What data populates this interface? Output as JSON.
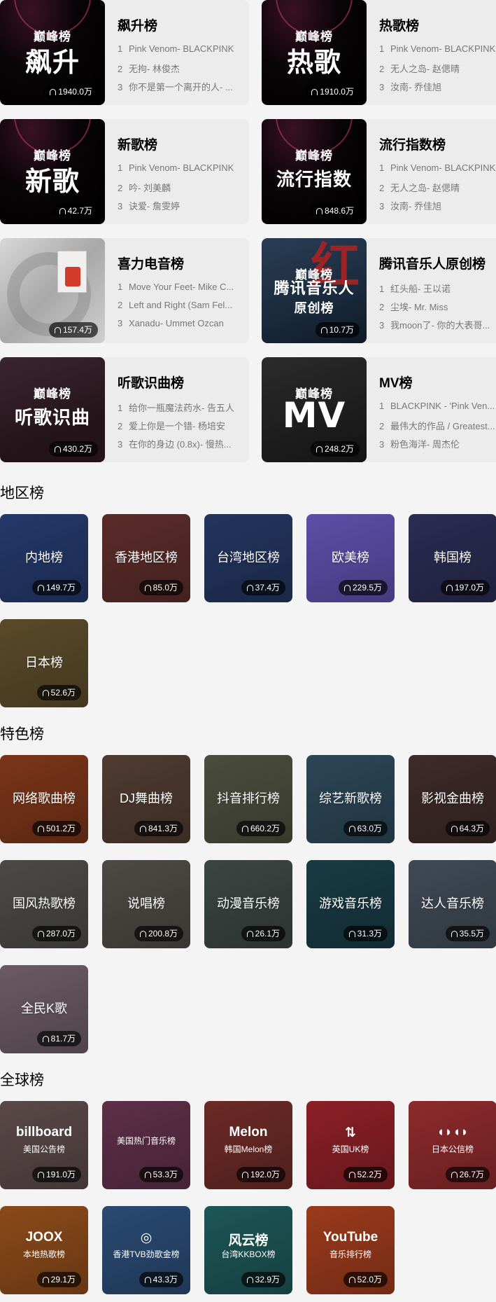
{
  "top_charts": [
    {
      "id": "soaring",
      "title": "飙升榜",
      "cover_logo": "巅峰榜",
      "cover_text": "飙升",
      "plays": "1940.0万",
      "items": [
        "Pink Venom- BLACKPINK",
        "无拘- 林俊杰",
        "你不是第一个离开的人- ..."
      ]
    },
    {
      "id": "hot",
      "title": "热歌榜",
      "cover_logo": "巅峰榜",
      "cover_text": "热歌",
      "plays": "1910.0万",
      "items": [
        "Pink Venom- BLACKPINK",
        "无人之岛- 赵偲晴",
        "汝南- 乔佳旭"
      ]
    },
    {
      "id": "new",
      "title": "新歌榜",
      "cover_logo": "巅峰榜",
      "cover_text": "新歌",
      "plays": "42.7万",
      "items": [
        "Pink Venom- BLACKPINK",
        "吟- 刘美麟",
        "诀爱- 詹雯婷"
      ]
    },
    {
      "id": "trend",
      "title": "流行指数榜",
      "cover_logo": "巅峰榜",
      "cover_text": "流行指数",
      "plays": "848.6万",
      "items": [
        "Pink Venom- BLACKPINK",
        "无人之岛- 赵偲晴",
        "汝南- 乔佳旭"
      ]
    },
    {
      "id": "electro",
      "title": "喜力电音榜",
      "cover_logo": "",
      "cover_text": "",
      "plays": "157.4万",
      "items": [
        "Move Your Feet- Mike C...",
        "Left and Right (Sam Fel...",
        "Xanadu- Ummet Ozcan"
      ]
    },
    {
      "id": "tme",
      "title": "腾讯音乐人原创榜",
      "cover_logo": "巅峰榜",
      "cover_text": "腾讯音乐人",
      "cover_text2": "原创榜",
      "plays": "10.7万",
      "items": [
        "红头船- 王以诺",
        "尘埃- Mr. Miss",
        "我moon了- 你的大表哥..."
      ]
    },
    {
      "id": "listen",
      "title": "听歌识曲榜",
      "cover_logo": "巅峰榜",
      "cover_text": "听歌识曲",
      "plays": "430.2万",
      "items": [
        "给你一瓶魔法药水- 告五人",
        "爱上你是一个错- 杨培安",
        "在你的身边 (0.8x)- 慢热..."
      ]
    },
    {
      "id": "mv",
      "title": "MV榜",
      "cover_logo": "巅峰榜",
      "cover_text": "MV",
      "plays": "248.2万",
      "items": [
        "BLACKPINK - 'Pink Ven...",
        "最伟大的作品 / Greatest...",
        "粉色海洋- 周杰伦"
      ]
    }
  ],
  "region": {
    "title": "地区榜",
    "tiles": [
      {
        "name": "region-mainland",
        "label": "内地榜",
        "plays": "149.7万",
        "color": "#24386a"
      },
      {
        "name": "region-hongkong",
        "label": "香港地区榜",
        "plays": "85.0万",
        "color": "#5a2c2a"
      },
      {
        "name": "region-taiwan",
        "label": "台湾地区榜",
        "plays": "37.4万",
        "color": "#23355e"
      },
      {
        "name": "region-western",
        "label": "欧美榜",
        "plays": "229.5万",
        "color": "#5d4ea8"
      },
      {
        "name": "region-korea",
        "label": "韩国榜",
        "plays": "197.0万",
        "color": "#2a2c52"
      },
      {
        "name": "region-japan",
        "label": "日本榜",
        "plays": "52.6万",
        "color": "#5a4a2a"
      }
    ]
  },
  "feature": {
    "title": "特色榜",
    "tiles": [
      {
        "name": "feature-internet",
        "label": "网络歌曲榜",
        "plays": "501.2万",
        "color": "#7a3519"
      },
      {
        "name": "feature-dj",
        "label": "DJ舞曲榜",
        "plays": "841.3万",
        "color": "#4f3b31"
      },
      {
        "name": "feature-douyin",
        "label": "抖音排行榜",
        "plays": "660.2万",
        "color": "#4a4d3d"
      },
      {
        "name": "feature-variety",
        "label": "综艺新歌榜",
        "plays": "63.0万",
        "color": "#2c4656"
      },
      {
        "name": "feature-film",
        "label": "影视金曲榜",
        "plays": "64.3万",
        "color": "#3e2a2a"
      },
      {
        "name": "feature-guofeng",
        "label": "国风热歌榜",
        "plays": "287.0万",
        "color": "#4b4a46"
      },
      {
        "name": "feature-rap",
        "label": "说唱榜",
        "plays": "200.8万",
        "color": "#4d4a45"
      },
      {
        "name": "feature-anime",
        "label": "动漫音乐榜",
        "plays": "26.1万",
        "color": "#3b4542"
      },
      {
        "name": "feature-game",
        "label": "游戏音乐榜",
        "plays": "31.3万",
        "color": "#193a44"
      },
      {
        "name": "feature-talent",
        "label": "达人音乐榜",
        "plays": "35.5万",
        "color": "#404a55"
      },
      {
        "name": "feature-kge",
        "label": "全民K歌",
        "plays": "81.7万",
        "color": "#6b5a62"
      }
    ]
  },
  "global": {
    "title": "全球榜",
    "tiles": [
      {
        "name": "global-billboard",
        "logo": "billboard",
        "label": "美国公告榜",
        "plays": "191.0万",
        "color": "#5a4849"
      },
      {
        "name": "global-us-hot",
        "logo": "",
        "label": "美国热门音乐榜",
        "plays": "53.3万",
        "color": "#5d2f48"
      },
      {
        "name": "global-melon",
        "logo": "Melon",
        "label": "韩国Melon榜",
        "plays": "192.0万",
        "color": "#6b2a26"
      },
      {
        "name": "global-uk",
        "logo": "⇅",
        "label": "英国UK榜",
        "plays": "52.2万",
        "color": "#8a2026"
      },
      {
        "name": "global-oricon",
        "logo": "◖◗◖◗",
        "label": "日本公信榜",
        "plays": "26.7万",
        "color": "#8c2a2c"
      },
      {
        "name": "global-joox",
        "logo": "JOOX",
        "label": "本地热歌榜",
        "plays": "29.1万",
        "color": "#8a4a1a"
      },
      {
        "name": "global-tvb",
        "logo": "◎",
        "label": "香港TVB劲歌金榜",
        "plays": "43.3万",
        "color": "#2a4a72"
      },
      {
        "name": "global-kkbox",
        "logo": "风云榜",
        "label": "台湾KKBOX榜",
        "plays": "32.9万",
        "color": "#1d5656"
      },
      {
        "name": "global-youtube",
        "logo": "YouTube",
        "label": "音乐排行榜",
        "plays": "52.0万",
        "color": "#9a3a1c"
      }
    ]
  }
}
